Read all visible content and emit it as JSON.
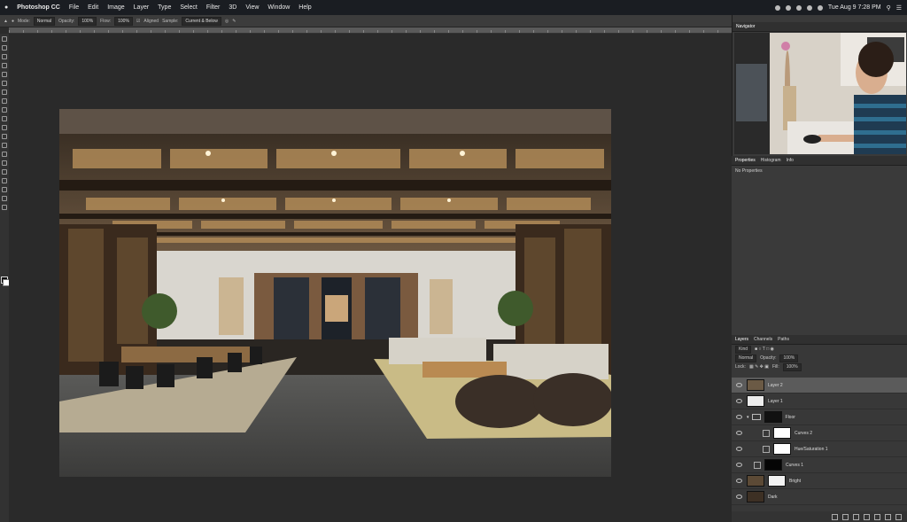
{
  "menubar": {
    "apple": "",
    "app": "Photoshop CC",
    "items": [
      "File",
      "Edit",
      "Image",
      "Layer",
      "Type",
      "Select",
      "Filter",
      "3D",
      "View",
      "Window",
      "Help"
    ],
    "clock": "Tue Aug 9 7:28 PM"
  },
  "options": {
    "mode_label": "Mode:",
    "mode_value": "Normal",
    "opacity_label": "Opacity:",
    "opacity_value": "100%",
    "flow_label": "Flow:",
    "flow_value": "100%",
    "aligned_label": "Aligned",
    "sample_label": "Sample:",
    "sample_value": "Current & Below"
  },
  "panels": {
    "navigator_tab": "Navigator",
    "properties_tab": "Properties",
    "histogram_tab": "Histogram",
    "info_tab": "Info",
    "properties_text": "No Properties",
    "layers_tab": "Layers",
    "channels_tab": "Channels",
    "paths_tab": "Paths"
  },
  "layers_controls": {
    "kind": "Kind",
    "blend": "Normal",
    "opacity_label": "Opacity:",
    "opacity_value": "100%",
    "lock_label": "Lock:",
    "fill_label": "Fill:",
    "fill_value": "100%"
  },
  "layers": [
    {
      "name": "Layer 2",
      "type": "image",
      "selected": true,
      "thumb": "#6b5a45"
    },
    {
      "name": "Layer 1",
      "type": "image",
      "selected": false,
      "thumb": "#ececec"
    },
    {
      "name": "Floor",
      "type": "group",
      "selected": false,
      "thumb": "#111111"
    },
    {
      "name": "Curves 2",
      "type": "adjust",
      "selected": false,
      "thumb": "#ffffff"
    },
    {
      "name": "Hue/Saturation 1",
      "type": "adjust",
      "selected": false,
      "thumb": "#ffffff"
    },
    {
      "name": "Curves 1",
      "type": "adjust",
      "selected": false,
      "thumb": "#050505"
    },
    {
      "name": "Bright",
      "type": "image",
      "selected": false,
      "thumb": "#5c4a36"
    },
    {
      "name": "Dark",
      "type": "image",
      "selected": false,
      "thumb": "#3d3024"
    }
  ],
  "colors": {
    "accent": "#5b5b5b",
    "panel": "#3a3a3a",
    "canvas": "#2a2a2a"
  }
}
